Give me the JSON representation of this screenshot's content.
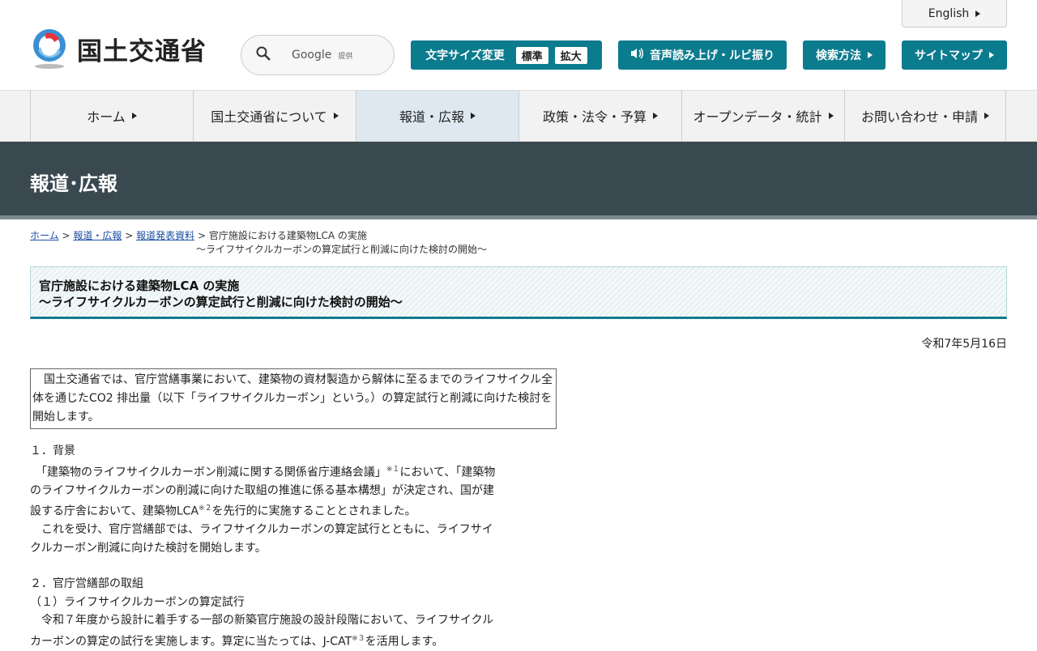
{
  "header": {
    "logo_text": "国土交通省",
    "search": {
      "brand": "Google",
      "suffix": "提供"
    },
    "english": "English",
    "font_size": {
      "label": "文字サイズ変更",
      "standard": "標準",
      "large": "拡大"
    },
    "speech": "音声読み上げ・ルビ振り",
    "search_method": "検索方法",
    "sitemap": "サイトマップ"
  },
  "nav": {
    "items": [
      "ホーム",
      "国土交通省について",
      "報道・広報",
      "政策・法令・予算",
      "オープンデータ・統計",
      "お問い合わせ・申請"
    ]
  },
  "page_title": "報道･広報",
  "breadcrumb": {
    "home": "ホーム",
    "press": "報道・広報",
    "release": "報道発表資料",
    "sep": ">",
    "current_line1": "官庁施設における建築物LCA の実施",
    "current_line2": "～ライフサイクルカーボンの算定試行と削減に向けた検討の開始～"
  },
  "headline": {
    "line1": "官庁施設における建築物LCA の実施",
    "line2": "～ライフサイクルカーボンの算定試行と削減に向けた検討の開始～"
  },
  "date": "令和7年5月16日",
  "lead": "　国土交通省では、官庁営繕事業において、建築物の資材製造から解体に至るまでのライフサイクル全体を通じたCO2 排出量（以下「ライフサイクルカーボン」という。）の算定試行と削減に向けた検討を開始します。",
  "section1": {
    "heading": "１．背景",
    "p1_a": "　「建築物のライフサイクルカーボン削減に関する関係省庁連絡会議」",
    "p1_sup1": "※１",
    "p1_b": "において、「建築物のライフサイクルカーボンの削減に向けた取組の推進に係る基本構想」が決定され、国が建設する庁舎において、建築物LCA",
    "p1_sup2": "※２",
    "p1_c": "を先行的に実施することとされました。",
    "p2": "　これを受け、官庁営繕部では、ライフサイクルカーボンの算定試行とともに、ライフサイクルカーボン削減に向けた検討を開始します。"
  },
  "section2": {
    "heading": "２．官庁営繕部の取組",
    "sub1": "（１）ライフサイクルカーボンの算定試行",
    "p1_a": "　令和７年度から設計に着手する一部の新築官庁施設の設計段階において、ライフサイクルカーボンの算定の試行を実施します。算定に当たっては、J-CAT",
    "p1_sup": "※３",
    "p1_b": "を活用します。"
  }
}
